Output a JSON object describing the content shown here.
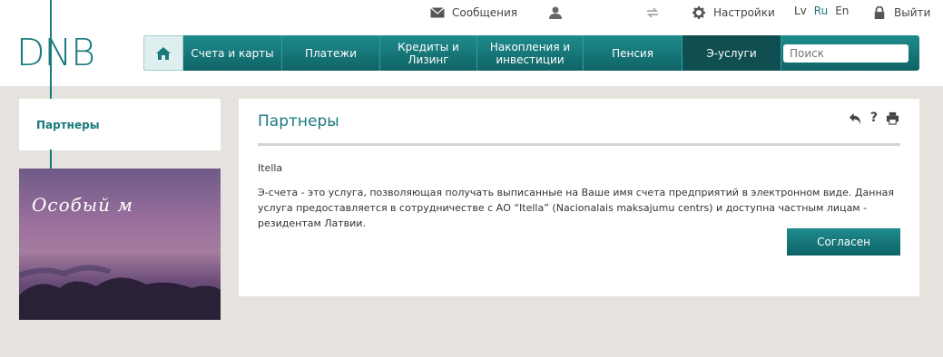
{
  "logo": {
    "text": "DNB"
  },
  "utility": {
    "messages": "Сообщения",
    "settings": "Настройки",
    "logout": "Выйти",
    "languages": [
      "Lv",
      "Ru",
      "En"
    ],
    "active_language": "Ru"
  },
  "nav": {
    "items": [
      "Счета и карты",
      "Платежи",
      "Кредиты и Лизинг",
      "Накопления и инвестиции",
      "Пенсия",
      "Э-услуги"
    ],
    "search_placeholder": "Поиск"
  },
  "sidebar": {
    "label": "Партнеры"
  },
  "banner": {
    "text": "Особый м"
  },
  "main": {
    "title": "Партнеры",
    "partner_name": "Itella",
    "description": "Э-счета - это услуга, позволяющая получать выписанные на Ваше имя счета предприятий в электронном виде. Данная услуга предоставляется в сотрудничестве с АО “Itella” (Nacionalais maksajumu centrs) и доступна частным лицам - резидентам Латвии.",
    "agree_button": "Согласен"
  },
  "colors": {
    "brand": "#19797d",
    "nav_dark": "#0f4f52",
    "background": "#e6e2dd"
  }
}
